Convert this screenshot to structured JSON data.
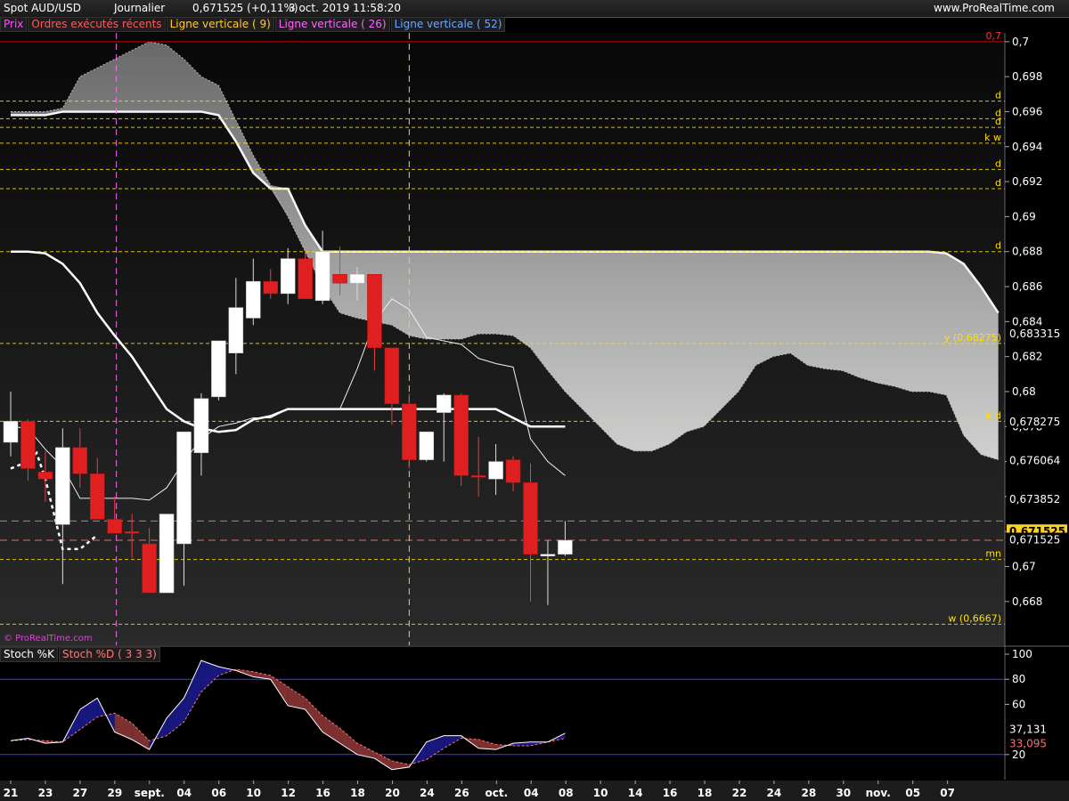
{
  "header": {
    "instrument": "Spot AUD/USD",
    "period": "Journalier",
    "quote": "0,671525 (+0,11%)",
    "datetime": "3 oct. 2019 11:58:20",
    "site": "www.ProRealTime.com"
  },
  "legend": {
    "items": [
      {
        "label": "Prix",
        "color": "#ff4fff"
      },
      {
        "label": "Ordres exécutés récents",
        "color": "#ff5a5a"
      },
      {
        "label": "Ligne verticale ( 9)",
        "color": "#ffcc33"
      },
      {
        "label": "Ligne verticale ( 26)",
        "color": "#ff66ff"
      },
      {
        "label": "Ligne verticale ( 52)",
        "color": "#6fa8ff"
      }
    ]
  },
  "credit": "© ProRealTime.com",
  "stoch_legend": {
    "items": [
      {
        "label": "Stoch %K",
        "color": "#ffffff"
      },
      {
        "label": "Stoch %D ( 3 3 3)",
        "color": "#ff7a7a"
      }
    ]
  },
  "colors": {
    "up": "#ffffff",
    "down": "#e02020",
    "guide": "#ffe000",
    "redline": "#cc0000",
    "stoch_k": "#ffffff",
    "stoch_d": "#ff7070",
    "stoch_up_fill": "#1a1a8a",
    "stoch_down_fill": "#8a3535"
  },
  "chart_data": {
    "type": "candlestick",
    "price_axis": {
      "ylim": [
        0.6655,
        0.7005
      ],
      "ticks": [
        "0,7",
        "0,698",
        "0,696",
        "0,694",
        "0,692",
        "0,69",
        "0,688",
        "0,686",
        "0,684",
        "0,682",
        "0,68",
        "0,678",
        "0,676",
        "0,674",
        "0,672",
        "0,67",
        "0,668"
      ],
      "tick_values": [
        0.7,
        0.698,
        0.696,
        0.694,
        0.692,
        0.69,
        0.688,
        0.686,
        0.684,
        0.682,
        0.68,
        0.678,
        0.676,
        0.674,
        0.672,
        0.67,
        0.668
      ],
      "value_labels": [
        {
          "text": "0,683315",
          "value": 0.683315,
          "style": "plain"
        },
        {
          "text": "0,678275",
          "value": 0.678275,
          "style": "plain"
        },
        {
          "text": "0,676064",
          "value": 0.676064,
          "style": "plain"
        },
        {
          "text": "0,673852",
          "value": 0.673852,
          "style": "plain"
        },
        {
          "text": "0,671525",
          "value": 0.672,
          "style": "highlight"
        },
        {
          "text": "0,671525",
          "value": 0.671525,
          "style": "plain"
        }
      ]
    },
    "x_axis": {
      "labels": [
        "21",
        "23",
        "27",
        "29",
        "sept.",
        "04",
        "06",
        "10",
        "12",
        "16",
        "18",
        "20",
        "24",
        "26",
        "oct.",
        "04",
        "08",
        "10",
        "14",
        "16",
        "18",
        "22",
        "24",
        "28",
        "30",
        "nov.",
        "05",
        "07"
      ]
    },
    "candles": [
      {
        "o": 0.6771,
        "h": 0.68,
        "l": 0.6763,
        "c": 0.6783
      },
      {
        "o": 0.6783,
        "h": 0.6784,
        "l": 0.6749,
        "c": 0.6756
      },
      {
        "o": 0.6754,
        "h": 0.6766,
        "l": 0.6737,
        "c": 0.675
      },
      {
        "o": 0.6724,
        "h": 0.6779,
        "l": 0.669,
        "c": 0.6768
      },
      {
        "o": 0.6768,
        "h": 0.6779,
        "l": 0.6745,
        "c": 0.6753
      },
      {
        "o": 0.6753,
        "h": 0.6762,
        "l": 0.6729,
        "c": 0.6727
      },
      {
        "o": 0.6727,
        "h": 0.674,
        "l": 0.672,
        "c": 0.6719
      },
      {
        "o": 0.672,
        "h": 0.673,
        "l": 0.6705,
        "c": 0.6719
      },
      {
        "o": 0.6713,
        "h": 0.6722,
        "l": 0.6705,
        "c": 0.6685
      },
      {
        "o": 0.6685,
        "h": 0.672,
        "l": 0.6688,
        "c": 0.673
      },
      {
        "o": 0.6713,
        "h": 0.6766,
        "l": 0.6689,
        "c": 0.6777
      },
      {
        "o": 0.6765,
        "h": 0.6799,
        "l": 0.6752,
        "c": 0.6796
      },
      {
        "o": 0.6797,
        "h": 0.6823,
        "l": 0.6795,
        "c": 0.6829
      },
      {
        "o": 0.6822,
        "h": 0.6865,
        "l": 0.681,
        "c": 0.6848
      },
      {
        "o": 0.6842,
        "h": 0.6876,
        "l": 0.6838,
        "c": 0.6863
      },
      {
        "o": 0.6863,
        "h": 0.687,
        "l": 0.6853,
        "c": 0.6856
      },
      {
        "o": 0.6856,
        "h": 0.6882,
        "l": 0.685,
        "c": 0.6876
      },
      {
        "o": 0.6876,
        "h": 0.688,
        "l": 0.6863,
        "c": 0.6853
      },
      {
        "o": 0.6852,
        "h": 0.6892,
        "l": 0.685,
        "c": 0.688
      },
      {
        "o": 0.6867,
        "h": 0.6883,
        "l": 0.6855,
        "c": 0.6862
      },
      {
        "o": 0.6862,
        "h": 0.6871,
        "l": 0.6852,
        "c": 0.6867
      },
      {
        "o": 0.6867,
        "h": 0.6866,
        "l": 0.6812,
        "c": 0.6825
      },
      {
        "o": 0.6825,
        "h": 0.6825,
        "l": 0.6781,
        "c": 0.6793
      },
      {
        "o": 0.6793,
        "h": 0.6799,
        "l": 0.6756,
        "c": 0.6761
      },
      {
        "o": 0.6761,
        "h": 0.6773,
        "l": 0.676,
        "c": 0.6777
      },
      {
        "o": 0.6788,
        "h": 0.6799,
        "l": 0.676,
        "c": 0.6798
      },
      {
        "o": 0.6798,
        "h": 0.6799,
        "l": 0.6746,
        "c": 0.6752
      },
      {
        "o": 0.6752,
        "h": 0.6774,
        "l": 0.674,
        "c": 0.6751
      },
      {
        "o": 0.675,
        "h": 0.677,
        "l": 0.6741,
        "c": 0.676
      },
      {
        "o": 0.6761,
        "h": 0.6763,
        "l": 0.6743,
        "c": 0.6748
      },
      {
        "o": 0.6748,
        "h": 0.6759,
        "l": 0.668,
        "c": 0.6707
      },
      {
        "o": 0.6707,
        "h": 0.6715,
        "l": 0.6678,
        "c": 0.6707
      },
      {
        "o": 0.6707,
        "h": 0.6726,
        "l": 0.6706,
        "c": 0.6715
      }
    ],
    "ichimoku": {
      "tenkan": [
        0.678,
        0.6779,
        0.6767,
        0.6757,
        0.6739,
        0.6739,
        0.6739,
        0.6739,
        0.6738,
        0.6745,
        0.676,
        0.6773,
        0.678,
        0.6782,
        0.6785,
        0.6785,
        0.679,
        0.679,
        0.679,
        0.679,
        0.6813,
        0.684,
        0.6853,
        0.6847,
        0.6831,
        0.6829,
        0.6827,
        0.6819,
        0.6816,
        0.6814,
        0.6773,
        0.676,
        0.6752
      ],
      "kijun": [
        0.688,
        0.688,
        0.6879,
        0.6873,
        0.6862,
        0.6845,
        0.6832,
        0.682,
        0.6805,
        0.679,
        0.6783,
        0.6779,
        0.6777,
        0.6778,
        0.6784,
        0.6786,
        0.679,
        0.679,
        0.679,
        0.679,
        0.679,
        0.679,
        0.679,
        0.679,
        0.679,
        0.679,
        0.679,
        0.679,
        0.679,
        0.6785,
        0.678,
        0.678,
        0.678
      ],
      "senkou_a": [
        0.6958,
        0.6958,
        0.6958,
        0.696,
        0.696,
        0.696,
        0.696,
        0.696,
        0.696,
        0.696,
        0.696,
        0.696,
        0.6958,
        0.6943,
        0.6925,
        0.6916,
        0.6916,
        0.6895,
        0.688,
        0.688,
        0.688,
        0.688,
        0.688,
        0.688,
        0.688,
        0.688,
        0.688,
        0.688,
        0.688,
        0.688,
        0.688,
        0.688,
        0.688,
        0.688,
        0.688,
        0.688,
        0.688,
        0.688,
        0.688,
        0.688,
        0.688,
        0.688,
        0.688,
        0.688,
        0.688,
        0.688,
        0.688,
        0.688,
        0.688,
        0.688,
        0.688,
        0.688,
        0.688,
        0.688,
        0.6879,
        0.6873,
        0.686,
        0.6845
      ],
      "senkou_b": [
        0.696,
        0.696,
        0.696,
        0.6962,
        0.698,
        0.6985,
        0.699,
        0.6995,
        0.7,
        0.6998,
        0.699,
        0.698,
        0.6975,
        0.6955,
        0.6935,
        0.6918,
        0.69,
        0.688,
        0.686,
        0.6845,
        0.6842,
        0.684,
        0.6838,
        0.6832,
        0.683,
        0.683,
        0.683,
        0.6833,
        0.6833,
        0.6832,
        0.6825,
        0.6812,
        0.68,
        0.679,
        0.678,
        0.677,
        0.6766,
        0.6766,
        0.677,
        0.6777,
        0.678,
        0.679,
        0.68,
        0.6815,
        0.682,
        0.6822,
        0.6815,
        0.6813,
        0.6812,
        0.6808,
        0.6805,
        0.6803,
        0.68,
        0.68,
        0.6798,
        0.6775,
        0.6764,
        0.6761
      ]
    },
    "chikou_points": [
      [
        0,
        0.6756
      ],
      [
        1,
        0.676
      ],
      [
        1.5,
        0.6765
      ],
      [
        2,
        0.675
      ],
      [
        3,
        0.671
      ],
      [
        4,
        0.671
      ],
      [
        5,
        0.6718
      ]
    ],
    "guide_lines": [
      {
        "value": 0.6966,
        "tag": "d"
      },
      {
        "value": 0.6956,
        "tag": "d"
      },
      {
        "value": 0.6951,
        "tag": "d"
      },
      {
        "value": 0.6942,
        "tag": "k w"
      },
      {
        "value": 0.6927,
        "tag": "d"
      },
      {
        "value": 0.6916,
        "tag": "d"
      },
      {
        "value": 0.688,
        "tag": "d"
      },
      {
        "value": 0.68275,
        "tag": "y (0,68275)"
      },
      {
        "value": 0.6783,
        "tag": "k d"
      },
      {
        "value": 0.6704,
        "tag": "mn"
      },
      {
        "value": 0.6667,
        "tag": "w (0,6667)"
      }
    ],
    "marker_line": {
      "value": 0.7,
      "text": "0,7"
    },
    "order_lines": [
      0.6726,
      0.6715
    ],
    "stoch": {
      "ylim": [
        0,
        105
      ],
      "ticks": [
        100,
        80,
        60,
        20
      ],
      "bands": [
        80,
        20
      ],
      "k": [
        31,
        33,
        29,
        30,
        56,
        65,
        38,
        32,
        24,
        49,
        65,
        95,
        90,
        87,
        82,
        80,
        59,
        56,
        38,
        29,
        20,
        17,
        8,
        10,
        30,
        35,
        35,
        25,
        24,
        29,
        30,
        30,
        37
      ],
      "d": [
        31,
        32,
        31,
        30,
        40,
        50,
        53,
        45,
        31,
        35,
        46,
        70,
        83,
        88,
        86,
        83,
        74,
        65,
        51,
        41,
        29,
        22,
        15,
        12,
        16,
        25,
        33,
        32,
        28,
        27,
        27,
        30,
        33
      ],
      "value_labels": [
        {
          "text": "37,131",
          "value": 37.131
        },
        {
          "text": "33,095",
          "value": 33.095
        }
      ]
    }
  }
}
